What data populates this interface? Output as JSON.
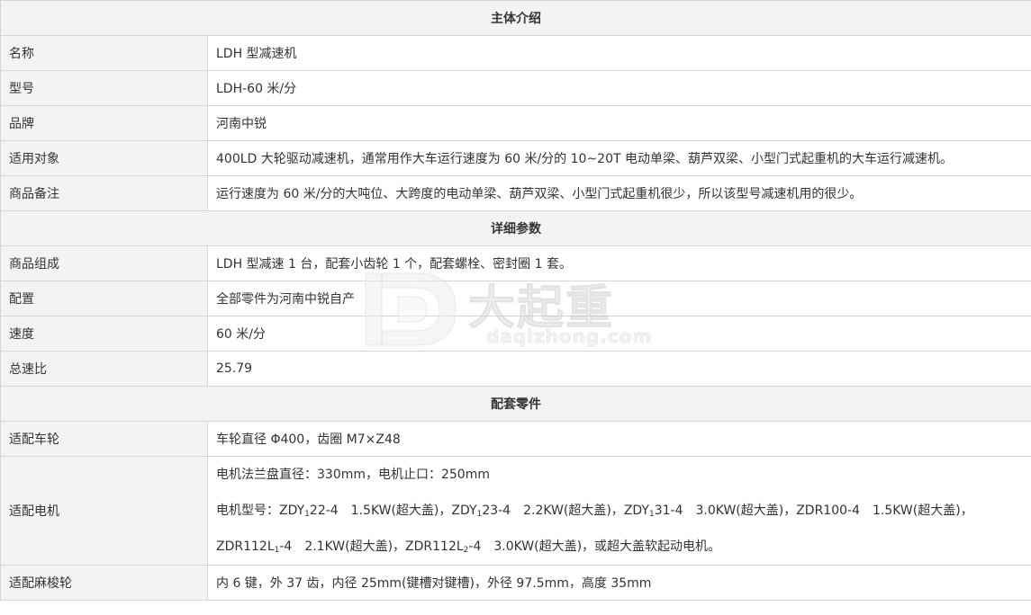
{
  "sections": {
    "intro": "主体介绍",
    "params": "详细参数",
    "parts": "配套零件"
  },
  "rows": {
    "name": {
      "label": "名称",
      "value": "LDH 型减速机"
    },
    "model": {
      "label": "型号",
      "value": "LDH-60 米/分"
    },
    "brand": {
      "label": "品牌",
      "value": "河南中锐"
    },
    "usage": {
      "label": "适用对象",
      "value": "400LD 大轮驱动减速机，通常用作大车运行速度为 60 米/分的 10~20T 电动单梁、葫芦双梁、小型门式起重机的大车运行减速机。"
    },
    "remark": {
      "label": "商品备注",
      "value": "运行速度为 60 米/分的大吨位、大跨度的电动单梁、葫芦双梁、小型门式起重机很少，所以该型号减速机用的很少。"
    },
    "composition": {
      "label": "商品组成",
      "value": "LDH 型减速 1 台，配套小齿轮 1 个，配套螺栓、密封圈 1 套。"
    },
    "config": {
      "label": "配置",
      "value": "全部零件为河南中锐自产"
    },
    "speed": {
      "label": "速度",
      "value": "60 米/分"
    },
    "ratio": {
      "label": "总速比",
      "value": "25.79"
    },
    "wheel": {
      "label": "适配车轮",
      "value": "车轮直径 Φ400，齿圈 M7×Z48"
    },
    "motor": {
      "label": "适配电机",
      "line1": "电机法兰盘直径：330mm，电机止口：250mm",
      "line2": {
        "prefix": "电机型号：",
        "m1": "ZDY",
        "m1_sub": "1",
        "m1_rest": "22-4　1.5KW(超大盖)，",
        "m2": "ZDY",
        "m2_sub": "1",
        "m2_rest": "23-4　2.2KW(超大盖)，",
        "m3": "ZDY",
        "m3_sub": "1",
        "m3_rest": "31-4　3.0KW(超大盖)，ZDR100-4　1.5KW(超大盖)，"
      },
      "line3": {
        "m4": "ZDR112L",
        "m4_sub": "1",
        "m4_rest": "-4　2.1KW(超大盖)，",
        "m5": "ZDR112L",
        "m5_sub": "2",
        "m5_rest": "-4　3.0KW(超大盖)，或超大盖软起动电机。"
      }
    },
    "coupling": {
      "label": "适配麻梭轮",
      "value": "内 6 键，外 37 齿，内径 25mm(键槽对键槽)，外径 97.5mm，高度 35mm"
    }
  },
  "watermark": {
    "brand": "大起重",
    "url": "daqizhong.com"
  }
}
